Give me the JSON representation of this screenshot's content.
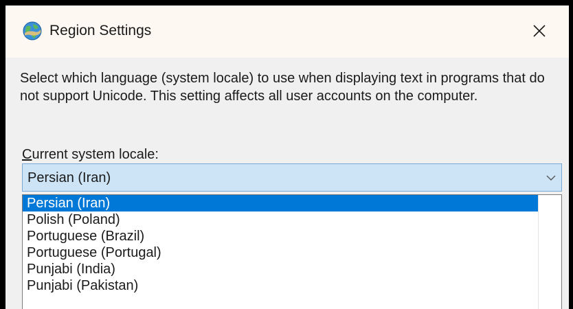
{
  "window": {
    "title": "Region Settings",
    "close_symbol": "✕"
  },
  "content": {
    "description": "Select which language (system locale) to use when displaying text in programs that do not support Unicode. This setting affects all user accounts on the computer.",
    "locale_label_first": "C",
    "locale_label_rest": "urrent system locale:"
  },
  "locale_select": {
    "value": "Persian (Iran)",
    "options": [
      "Persian (Iran)",
      "Polish (Poland)",
      "Portuguese (Brazil)",
      "Portuguese (Portugal)",
      "Punjabi (India)",
      "Punjabi (Pakistan)"
    ],
    "selected_index": 0
  },
  "colors": {
    "selection": "#0078d7",
    "combo_background": "#cde4f7",
    "combo_border": "#7aa7d6",
    "titlebar": "#fdf9f2",
    "dialog_background": "#f0f0f0"
  },
  "icons": {
    "title": "globe-icon",
    "close": "close-icon",
    "dropdown": "chevron-down-icon"
  }
}
